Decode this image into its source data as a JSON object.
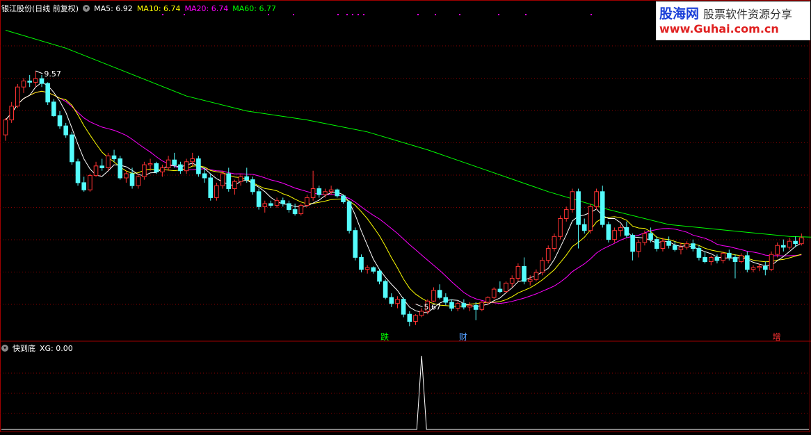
{
  "legend": {
    "stock_label": "银江股份(日线 前复权)",
    "ma5": "MA5: 6.92",
    "ma10": "MA10: 6.74",
    "ma20": "MA20: 6.74",
    "ma60": "MA60: 6.77"
  },
  "indicator": {
    "name": "快到底",
    "value": "XG: 0.00"
  },
  "watermark": {
    "site_cn": "股海网",
    "tagline": "股票软件资源分享",
    "url": "www.Guhai.com.cn"
  },
  "colors": {
    "up": "#ff3232",
    "down": "#54fcfc",
    "ma5": "#ffffff",
    "ma10": "#ffff00",
    "ma20": "#ff00ff",
    "ma60": "#00ff00",
    "grid": "#8b0000",
    "frame": "#a00000"
  },
  "chart_data": {
    "type": "candlestick",
    "ylim": [
      5.2,
      10.5
    ],
    "annotations": [
      {
        "label": "9.57",
        "type": "high",
        "index": 5,
        "value": 9.57
      },
      {
        "label": "5.67",
        "type": "low",
        "index": 68,
        "value": 5.67
      }
    ],
    "markers": [
      {
        "label": "跌",
        "index": 63,
        "color": "#00ff00"
      },
      {
        "label": "财",
        "index": 76,
        "color": "#54a0ff"
      },
      {
        "label": "增",
        "index": 128,
        "color": "#ff3232"
      }
    ],
    "candles": [
      [
        8.5,
        8.78,
        8.4,
        8.75
      ],
      [
        8.75,
        9.05,
        8.7,
        8.98
      ],
      [
        8.98,
        9.35,
        8.95,
        9.3
      ],
      [
        9.3,
        9.45,
        9.2,
        9.4
      ],
      [
        9.4,
        9.5,
        9.3,
        9.38
      ],
      [
        9.38,
        9.57,
        9.3,
        9.44
      ],
      [
        9.44,
        9.5,
        9.3,
        9.36
      ],
      [
        9.36,
        9.38,
        9.0,
        9.05
      ],
      [
        9.05,
        9.1,
        8.8,
        8.82
      ],
      [
        8.82,
        8.9,
        8.6,
        8.65
      ],
      [
        8.65,
        8.7,
        8.45,
        8.5
      ],
      [
        8.5,
        8.55,
        8.0,
        8.05
      ],
      [
        8.05,
        8.1,
        7.65,
        7.7
      ],
      [
        7.7,
        7.8,
        7.55,
        7.58
      ],
      [
        7.58,
        7.85,
        7.55,
        7.82
      ],
      [
        7.82,
        8.05,
        7.8,
        7.98
      ],
      [
        7.98,
        8.1,
        7.9,
        7.95
      ],
      [
        7.95,
        8.2,
        7.9,
        8.15
      ],
      [
        8.15,
        8.25,
        8.05,
        8.1
      ],
      [
        8.1,
        8.15,
        7.75,
        7.78
      ],
      [
        7.78,
        7.9,
        7.7,
        7.85
      ],
      [
        7.85,
        7.95,
        7.6,
        7.65
      ],
      [
        7.65,
        7.85,
        7.6,
        7.8
      ],
      [
        7.8,
        8.05,
        7.75,
        8.0
      ],
      [
        8.0,
        8.1,
        7.9,
        8.02
      ],
      [
        8.02,
        8.05,
        7.85,
        7.88
      ],
      [
        7.88,
        8.0,
        7.8,
        7.95
      ],
      [
        7.95,
        8.15,
        7.9,
        8.08
      ],
      [
        8.08,
        8.2,
        7.95,
        8.0
      ],
      [
        8.0,
        8.05,
        7.85,
        7.9
      ],
      [
        7.9,
        8.1,
        7.85,
        8.05
      ],
      [
        8.05,
        8.2,
        7.98,
        8.1
      ],
      [
        8.1,
        8.15,
        7.8,
        7.85
      ],
      [
        7.85,
        7.95,
        7.7,
        7.78
      ],
      [
        7.78,
        7.85,
        7.4,
        7.45
      ],
      [
        7.45,
        7.7,
        7.4,
        7.65
      ],
      [
        7.65,
        7.9,
        7.6,
        7.85
      ],
      [
        7.85,
        7.95,
        7.55,
        7.6
      ],
      [
        7.6,
        7.75,
        7.5,
        7.72
      ],
      [
        7.72,
        7.85,
        7.65,
        7.8
      ],
      [
        7.8,
        7.95,
        7.7,
        7.75
      ],
      [
        7.75,
        7.8,
        7.5,
        7.55
      ],
      [
        7.55,
        7.6,
        7.25,
        7.3
      ],
      [
        7.3,
        7.4,
        7.2,
        7.35
      ],
      [
        7.35,
        7.4,
        7.28,
        7.32
      ],
      [
        7.32,
        7.45,
        7.28,
        7.4
      ],
      [
        7.4,
        7.45,
        7.3,
        7.35
      ],
      [
        7.35,
        7.4,
        7.2,
        7.25
      ],
      [
        7.25,
        7.35,
        7.15,
        7.18
      ],
      [
        7.18,
        7.35,
        7.15,
        7.32
      ],
      [
        7.32,
        7.5,
        7.3,
        7.45
      ],
      [
        7.45,
        7.9,
        7.4,
        7.6
      ],
      [
        7.6,
        7.65,
        7.45,
        7.5
      ],
      [
        7.5,
        7.6,
        7.45,
        7.55
      ],
      [
        7.55,
        7.65,
        7.5,
        7.58
      ],
      [
        7.58,
        7.6,
        7.45,
        7.48
      ],
      [
        7.48,
        7.5,
        7.35,
        7.38
      ],
      [
        7.38,
        7.4,
        6.85,
        6.9
      ],
      [
        6.9,
        6.95,
        6.4,
        6.45
      ],
      [
        6.45,
        6.5,
        6.2,
        6.25
      ],
      [
        6.25,
        6.32,
        6.18,
        6.28
      ],
      [
        6.28,
        6.3,
        6.18,
        6.22
      ],
      [
        6.22,
        6.25,
        6.0,
        6.05
      ],
      [
        6.05,
        6.08,
        5.75,
        5.78
      ],
      [
        5.78,
        5.85,
        5.62,
        5.68
      ],
      [
        5.68,
        5.8,
        5.6,
        5.75
      ],
      [
        5.75,
        5.78,
        5.45,
        5.5
      ],
      [
        5.5,
        5.55,
        5.3,
        5.38
      ],
      [
        5.38,
        5.5,
        5.32,
        5.48
      ],
      [
        5.48,
        5.6,
        5.45,
        5.55
      ],
      [
        5.55,
        5.75,
        5.5,
        5.72
      ],
      [
        5.72,
        5.95,
        5.7,
        5.9
      ],
      [
        5.9,
        6.0,
        5.75,
        5.78
      ],
      [
        5.78,
        5.85,
        5.65,
        5.7
      ],
      [
        5.7,
        5.75,
        5.55,
        5.6
      ],
      [
        5.6,
        5.72,
        5.55,
        5.68
      ],
      [
        5.68,
        5.75,
        5.58,
        5.62
      ],
      [
        5.62,
        5.7,
        5.55,
        5.65
      ],
      [
        5.65,
        5.7,
        5.4,
        5.58
      ],
      [
        5.58,
        5.72,
        5.55,
        5.7
      ],
      [
        5.7,
        5.8,
        5.65,
        5.78
      ],
      [
        5.78,
        5.95,
        5.75,
        5.92
      ],
      [
        5.92,
        6.05,
        5.85,
        5.88
      ],
      [
        5.88,
        6.05,
        5.85,
        6.02
      ],
      [
        6.02,
        6.15,
        5.95,
        6.1
      ],
      [
        6.1,
        6.35,
        6.05,
        6.3
      ],
      [
        6.3,
        6.45,
        6.0,
        6.05
      ],
      [
        6.05,
        6.15,
        5.98,
        6.08
      ],
      [
        6.08,
        6.25,
        6.05,
        6.2
      ],
      [
        6.2,
        6.45,
        6.15,
        6.4
      ],
      [
        6.4,
        6.65,
        6.35,
        6.6
      ],
      [
        6.6,
        6.85,
        6.55,
        6.8
      ],
      [
        6.8,
        7.15,
        6.75,
        7.1
      ],
      [
        7.1,
        7.3,
        7.05,
        7.25
      ],
      [
        7.25,
        7.6,
        7.2,
        7.55
      ],
      [
        7.55,
        7.6,
        6.6,
        7.0
      ],
      [
        7.0,
        7.1,
        6.85,
        6.9
      ],
      [
        6.9,
        7.35,
        6.85,
        7.3
      ],
      [
        7.3,
        7.6,
        7.25,
        7.55
      ],
      [
        7.55,
        7.65,
        6.95,
        7.0
      ],
      [
        7.0,
        7.05,
        6.7,
        6.75
      ],
      [
        6.75,
        6.95,
        6.7,
        6.9
      ],
      [
        6.9,
        7.0,
        6.8,
        6.95
      ],
      [
        6.95,
        7.05,
        6.78,
        6.82
      ],
      [
        6.82,
        6.85,
        6.4,
        6.55
      ],
      [
        6.55,
        6.75,
        6.45,
        6.7
      ],
      [
        6.7,
        6.9,
        6.65,
        6.85
      ],
      [
        6.85,
        6.95,
        6.7,
        6.75
      ],
      [
        6.75,
        6.8,
        6.55,
        6.6
      ],
      [
        6.6,
        6.78,
        6.55,
        6.72
      ],
      [
        6.72,
        6.8,
        6.6,
        6.65
      ],
      [
        6.65,
        6.72,
        6.55,
        6.58
      ],
      [
        6.58,
        6.7,
        6.5,
        6.62
      ],
      [
        6.62,
        6.72,
        6.58,
        6.68
      ],
      [
        6.68,
        6.75,
        6.55,
        6.6
      ],
      [
        6.6,
        6.65,
        6.4,
        6.45
      ],
      [
        6.45,
        6.55,
        6.35,
        6.38
      ],
      [
        6.38,
        6.48,
        6.32,
        6.45
      ],
      [
        6.45,
        6.5,
        6.35,
        6.4
      ],
      [
        6.4,
        6.55,
        6.35,
        6.52
      ],
      [
        6.52,
        6.58,
        6.4,
        6.45
      ],
      [
        6.45,
        6.5,
        6.1,
        6.38
      ],
      [
        6.38,
        6.52,
        6.35,
        6.48
      ],
      [
        6.48,
        6.55,
        6.2,
        6.25
      ],
      [
        6.25,
        6.32,
        6.2,
        6.28
      ],
      [
        6.28,
        6.35,
        6.22,
        6.3
      ],
      [
        6.3,
        6.38,
        6.15,
        6.25
      ],
      [
        6.25,
        6.55,
        6.22,
        6.5
      ],
      [
        6.5,
        6.7,
        6.45,
        6.65
      ],
      [
        6.65,
        6.75,
        6.55,
        6.62
      ],
      [
        6.62,
        6.78,
        6.58,
        6.72
      ],
      [
        6.72,
        6.8,
        6.62,
        6.68
      ],
      [
        6.68,
        6.85,
        6.65,
        6.78
      ]
    ],
    "ma60": [
      [
        0,
        10.25
      ],
      [
        10,
        9.95
      ],
      [
        20,
        9.55
      ],
      [
        30,
        9.15
      ],
      [
        40,
        8.9
      ],
      [
        50,
        8.75
      ],
      [
        60,
        8.55
      ],
      [
        70,
        8.25
      ],
      [
        80,
        7.9
      ],
      [
        90,
        7.55
      ],
      [
        100,
        7.25
      ],
      [
        110,
        7.0
      ],
      [
        120,
        6.9
      ],
      [
        130,
        6.8
      ],
      [
        140,
        6.77
      ]
    ],
    "indicator": {
      "name": "XG",
      "signal_index": 69,
      "signal_value": 1,
      "ylim": [
        0,
        1
      ]
    }
  }
}
